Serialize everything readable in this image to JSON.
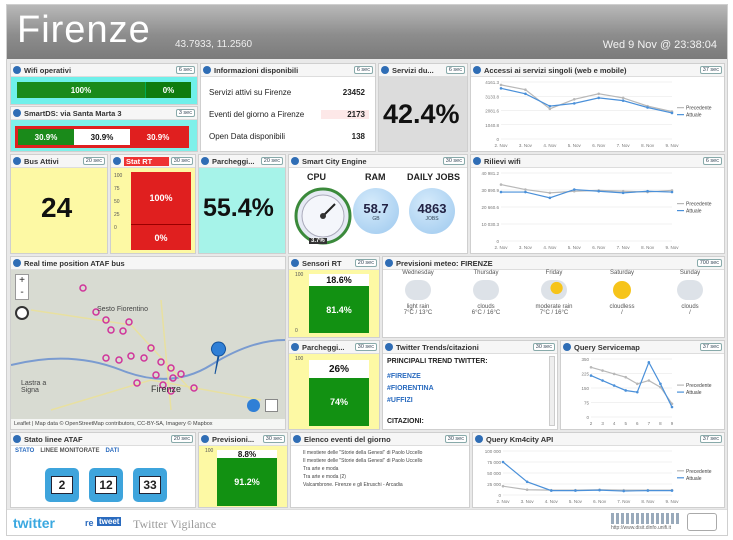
{
  "header": {
    "title": "Firenze",
    "coords": "43.7933, 11.2560",
    "date": "Wed 9 Nov @ 23:38:04"
  },
  "tags": {
    "t6": "6 sec",
    "t3": "3 sec",
    "t20": "20 sec",
    "t30": "30 sec",
    "t700": "700 sec",
    "t37": "37 sec"
  },
  "wifi": {
    "title": "Wifi operativi",
    "tag": "6 sec",
    "v1": "100%",
    "v2": "0%"
  },
  "smartds": {
    "title": "SmartDS: via Santa Marta 3",
    "tag": "3 sec",
    "v1": "30.9%",
    "v2": "30.9%",
    "v3": "30.9%"
  },
  "info": {
    "title": "Informazioni disponibili",
    "tag": "6 sec",
    "rows": [
      {
        "label": "Servizi attivi su Firenze",
        "value": "23452"
      },
      {
        "label": "Eventi del giorno a Firenze",
        "value": "2173"
      },
      {
        "label": "Open Data disponibili",
        "value": "138"
      }
    ]
  },
  "servizi": {
    "title": "Servizi du...",
    "tag": "6 sec",
    "value": "42.4%"
  },
  "accessi": {
    "title": "Accessi ai servizi singoli (web e mobile)",
    "tag": "37 sec",
    "legend": [
      "Precedente",
      "Attuale"
    ]
  },
  "bus": {
    "title": "Bus Attivi",
    "tag": "20 sec",
    "value": "24",
    "stat_tag": "Stat RT",
    "stat_tag2": "30 sec",
    "v1": "100%",
    "v2": "0%"
  },
  "parcheggi1": {
    "title": "Parcheggi...",
    "tag": "20 sec",
    "value": "55.4%"
  },
  "sce": {
    "title": "Smart City Engine",
    "tag": "30 sec",
    "cpu_label": "CPU",
    "ram_label": "RAM",
    "jobs_label": "DAILY JOBS",
    "cpu_value": "3.7%",
    "ram_value": "58.7",
    "ram_unit": "GB",
    "jobs_value": "4863",
    "jobs_unit": "JOBS"
  },
  "rilievi": {
    "title": "Rilievi wifi",
    "tag": "6 sec",
    "legend": [
      "Precedente",
      "Attuale"
    ]
  },
  "map": {
    "title": "Real time position ATAF bus",
    "labels": [
      "Sesto Fiorentino",
      "Lastra a Signa",
      "Firenze"
    ],
    "attribution": "Leaflet | Map data © OpenStreetMap contributors, CC-BY-SA, Imagery © Mapbox"
  },
  "sensori": {
    "title": "Sensori RT",
    "tag": "20 sec",
    "v1": "18.6%",
    "v2": "81.4%"
  },
  "meteo": {
    "title": "Previsioni meteo: FIRENZE",
    "tag": "700 sec",
    "days": [
      {
        "day": "Wednesday",
        "desc": "light rain",
        "temp": "7°C / 13°C",
        "icon": "rain-cloud-icon"
      },
      {
        "day": "Thursday",
        "desc": "clouds",
        "temp": "6°C / 16°C",
        "icon": "cloud-icon"
      },
      {
        "day": "Friday",
        "desc": "moderate rain",
        "temp": "7°C / 16°C",
        "icon": "sun-cloud-icon"
      },
      {
        "day": "Saturday",
        "desc": "cloudless",
        "temp": "/",
        "icon": "sun-icon"
      },
      {
        "day": "Sunday",
        "desc": "clouds",
        "temp": "/",
        "icon": "cloud-icon"
      }
    ]
  },
  "parcheggi2": {
    "title": "Parcheggi...",
    "tag": "30 sec",
    "v1": "26%",
    "v2": "74%"
  },
  "twitter": {
    "title": "Twitter Trends/citazioni",
    "tag": "30 sec",
    "heading": "PRINCIPALI TREND TWITTER:",
    "items": [
      "#FIRENZE",
      "#FIORENTINA",
      "#UFFIZI"
    ],
    "citazioni": "CITAZIONI:"
  },
  "servicemap": {
    "title": "Query Servicemap",
    "tag": "37 sec",
    "legend": [
      "Precedente",
      "Attuale"
    ]
  },
  "linee": {
    "title": "Stato linee ATAF",
    "tag": "20 sec",
    "tabs": [
      "STATO",
      "LINEE MONITORATE",
      "DATI"
    ],
    "buses": [
      "2",
      "12",
      "33"
    ]
  },
  "previsioni": {
    "title": "Previsioni...",
    "tag": "30 sec",
    "v1": "8.8%",
    "v2": "91.2%"
  },
  "eventi": {
    "title": "Elenco eventi del giorno",
    "tag": "30 sec",
    "items": [
      "Il mestiere delle \"Storie della Genesi\" di Paolo Uccello",
      "Il mestiere delle \"Storie della Genesi\" di Paolo Uccello",
      "Il mestiere delle \"Storie della Genesi\" di Paolo Uccello",
      "Tra arte e moda",
      "Tra arte e moda (2)",
      "Valcambrone. Firenze e gli Etruschi - Arcadia"
    ]
  },
  "km4city": {
    "title": "Query Km4city API",
    "tag": "37 sec",
    "legend": [
      "Precedente",
      "Attuale"
    ]
  },
  "footer": {
    "brand_a": "twitter",
    "brand_b": "re",
    "brand_c": "tweet",
    "brand_d": "Twitter Vigilance",
    "right": "http://www.disit.dinfo.unifi.it"
  },
  "chart_data": [
    {
      "type": "line",
      "name": "accessi",
      "title": "Accessi ai servizi singoli (web e mobile)",
      "categories": [
        "2. Nov",
        "3. Nov",
        "4. Nov",
        "5. Nov",
        "6. Nov",
        "7. Nov",
        "8. Nov",
        "9. Nov"
      ],
      "yticks": [
        "4161.3",
        "3133.8",
        "2081.6",
        "1040.8",
        "0"
      ],
      "ylim": [
        0,
        4161.3
      ],
      "series": [
        {
          "name": "Precedente",
          "values": [
            3950,
            3600,
            2200,
            2900,
            3300,
            3000,
            2400,
            2000
          ]
        },
        {
          "name": "Attuale",
          "values": [
            3700,
            3300,
            2400,
            2600,
            3000,
            2800,
            2300,
            1900
          ]
        }
      ]
    },
    {
      "type": "line",
      "name": "rilievi",
      "title": "Rilievi wifi",
      "categories": [
        "2. Nov",
        "3. Nov",
        "4. Nov",
        "5. Nov",
        "6. Nov",
        "7. Nov",
        "8. Nov",
        "9. Nov"
      ],
      "yticks": [
        "40 981.2",
        "30 890.9",
        "20 660.6",
        "10 030.3",
        "0"
      ],
      "ylim": [
        0,
        40981.2
      ],
      "series": [
        {
          "name": "Precedente",
          "values": [
            34000,
            31000,
            29000,
            30000,
            30500,
            30000,
            29500,
            30500
          ]
        },
        {
          "name": "Attuale",
          "values": [
            29500,
            29500,
            26000,
            31000,
            30000,
            29000,
            30000,
            29500
          ]
        }
      ]
    },
    {
      "type": "line",
      "name": "servicemap",
      "title": "Query Servicemap",
      "categories": [
        "2",
        "3",
        "4",
        "5",
        "6",
        "7",
        "8",
        "9"
      ],
      "yticks": [
        "350",
        "225",
        "150",
        "75",
        "0"
      ],
      "ylim": [
        0,
        350
      ],
      "series": [
        {
          "name": "Precedente",
          "values": [
            300,
            280,
            260,
            240,
            200,
            220,
            180,
            80
          ]
        },
        {
          "name": "Attuale",
          "values": [
            250,
            220,
            190,
            160,
            150,
            330,
            200,
            60
          ]
        }
      ]
    },
    {
      "type": "line",
      "name": "km4city",
      "title": "Query Km4city API",
      "categories": [
        "2. Nov",
        "3. Nov",
        "4. Nov",
        "5. Nov",
        "6. Nov",
        "7. Nov",
        "8. Nov",
        "9. Nov"
      ],
      "yticks": [
        "100 000",
        "75 000",
        "50 000",
        "25 000",
        "0"
      ],
      "ylim": [
        0,
        100000
      ],
      "series": [
        {
          "name": "Precedente",
          "values": [
            20000,
            12000,
            11000,
            11000,
            12000,
            11000,
            11000,
            11000
          ]
        },
        {
          "name": "Attuale",
          "values": [
            75000,
            30000,
            10000,
            10000,
            11000,
            9000,
            10000,
            10000
          ]
        }
      ]
    }
  ]
}
